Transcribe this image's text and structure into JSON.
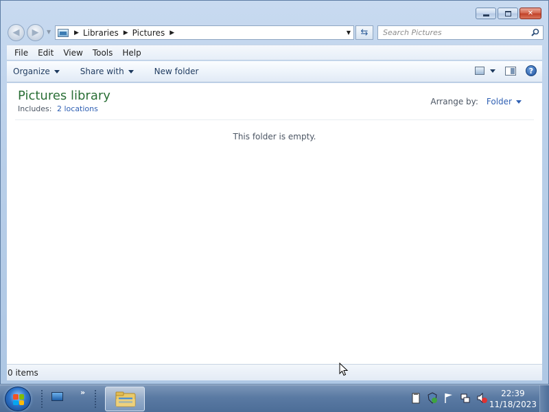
{
  "window": {
    "caption_buttons": [
      "minimize-button",
      "maximize-button",
      "close-button"
    ]
  },
  "address": {
    "breadcrumbs": [
      "Libraries",
      "Pictures"
    ],
    "search_placeholder": "Search Pictures"
  },
  "menu": {
    "items": [
      "File",
      "Edit",
      "View",
      "Tools",
      "Help"
    ]
  },
  "commands": {
    "organize": "Organize",
    "share_with": "Share with",
    "new_folder": "New folder"
  },
  "library": {
    "title": "Pictures library",
    "includes_label": "Includes:",
    "includes_link": "2 locations",
    "arrange_label": "Arrange by:",
    "arrange_value": "Folder",
    "empty_message": "This folder is empty."
  },
  "status": {
    "items": "0 items"
  },
  "taskbar": {
    "time": "22:39",
    "date": "11/18/2023",
    "quicklaunch_more": "»"
  },
  "colors": {
    "library_title": "#2a6f36",
    "link": "#2e5fb3"
  }
}
